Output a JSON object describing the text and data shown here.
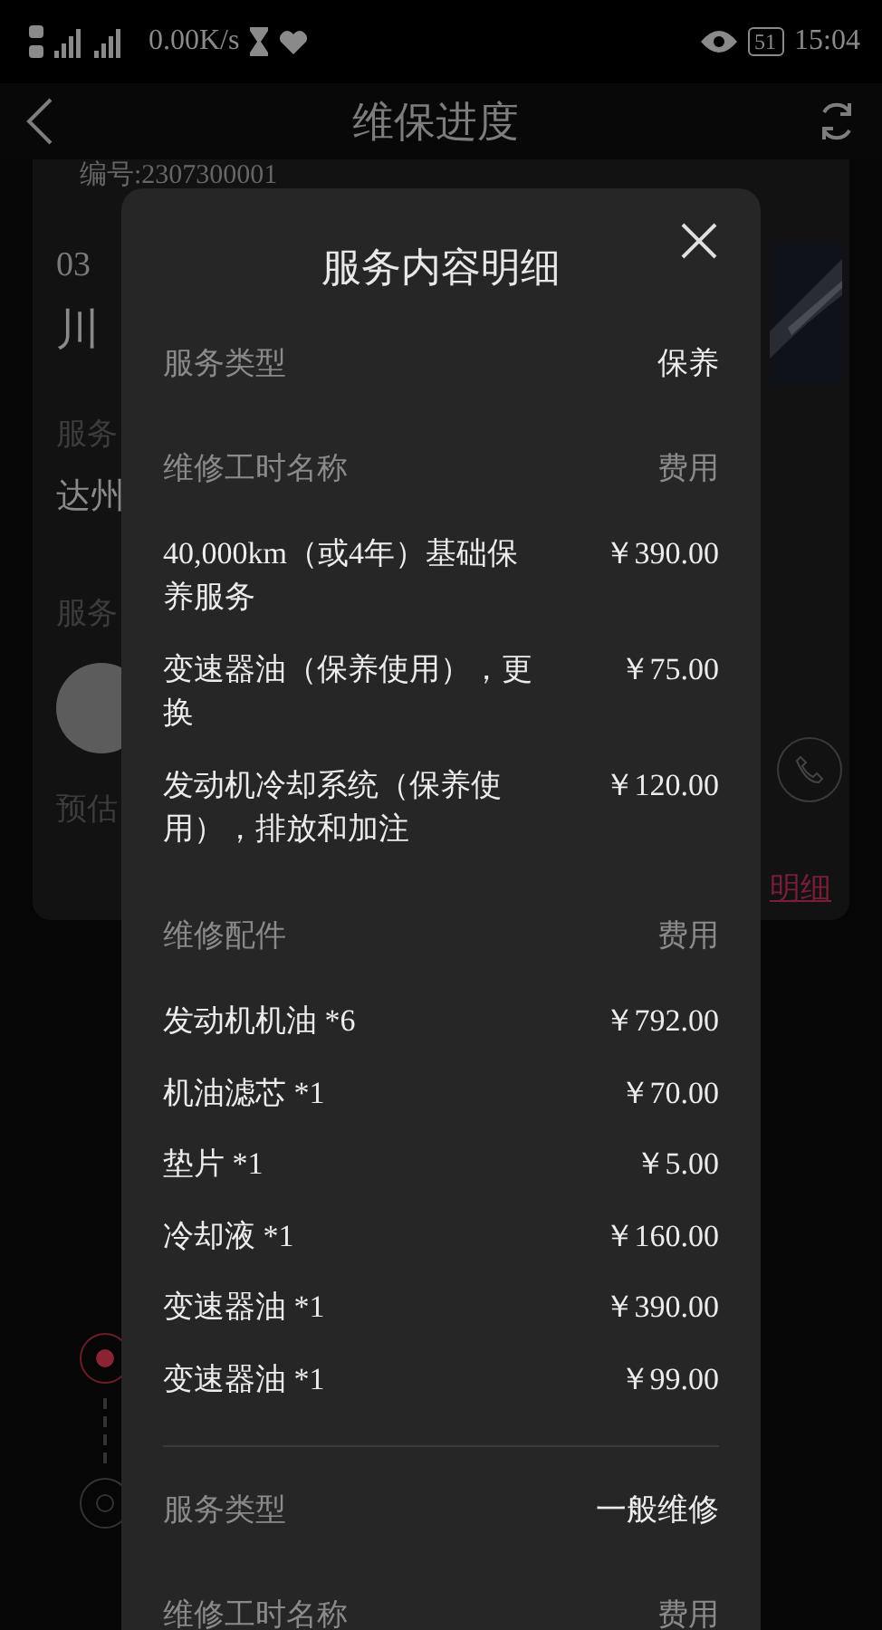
{
  "status_bar": {
    "network_speed": "0.00K/s",
    "battery": "51",
    "time": "15:04"
  },
  "header": {
    "title": "维保进度"
  },
  "order_card": {
    "number": "编号:2307300001",
    "date_fragment": "03",
    "plate_fragment": "川",
    "service_label": "服务",
    "service_value": "达州",
    "advisor_label": "服务",
    "estimate_label": "预估",
    "detail_link": "明细"
  },
  "timeline": [
    {
      "selected": true
    },
    {
      "selected": false
    }
  ],
  "dialog": {
    "title": "服务内容明细",
    "sections": [
      {
        "service_type_label": "服务类型",
        "service_type": "保养",
        "labor_header": "维修工时名称",
        "labor_fee_header": "费用",
        "labor_items": [
          {
            "name": "40,000km（或4年）基础保养服务",
            "price": "￥390.00"
          },
          {
            "name": "变速器油（保养使用），更换",
            "price": "￥75.00"
          },
          {
            "name": "发动机冷却系统（保养使用），排放和加注",
            "price": "￥120.00"
          }
        ],
        "parts_header": "维修配件",
        "parts_fee_header": "费用",
        "parts": [
          {
            "name": "发动机机油 *6",
            "price": "￥792.00"
          },
          {
            "name": "机油滤芯 *1",
            "price": "￥70.00"
          },
          {
            "name": "垫片 *1",
            "price": "￥5.00"
          },
          {
            "name": "冷却液 *1",
            "price": "￥160.00"
          },
          {
            "name": "变速器油 *1",
            "price": "￥390.00"
          },
          {
            "name": "变速器油 *1",
            "price": "￥99.00"
          }
        ]
      },
      {
        "service_type_label": "服务类型",
        "service_type": "一般维修",
        "labor_header": "维修工时名称",
        "labor_fee_header": "费用"
      }
    ]
  }
}
